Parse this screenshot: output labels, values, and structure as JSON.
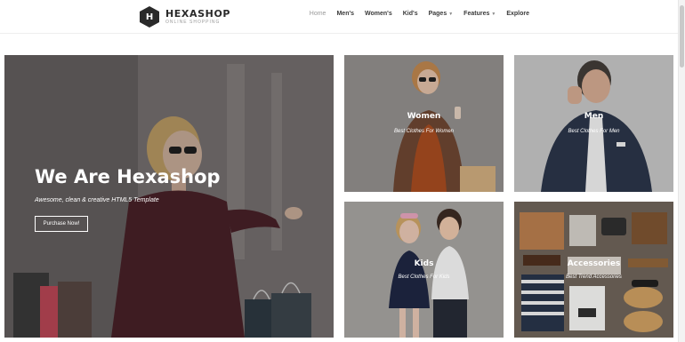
{
  "header": {
    "logo": {
      "letter": "H",
      "brand": "HEXASHOP",
      "tagline": "ONLINE SHOPPING"
    },
    "nav": [
      {
        "label": "Home",
        "active": true,
        "dropdown": false
      },
      {
        "label": "Men's",
        "active": false,
        "dropdown": false
      },
      {
        "label": "Women's",
        "active": false,
        "dropdown": false
      },
      {
        "label": "Kid's",
        "active": false,
        "dropdown": false
      },
      {
        "label": "Pages",
        "active": false,
        "dropdown": true
      },
      {
        "label": "Features",
        "active": false,
        "dropdown": true
      },
      {
        "label": "Explore",
        "active": false,
        "dropdown": false
      }
    ]
  },
  "hero": {
    "title": "We Are Hexashop",
    "subtitle": "Awesome, clean & creative HTML5 Template",
    "button_label": "Purchase Now!"
  },
  "categories": [
    {
      "title": "Women",
      "subtitle": "Best Clothes For Women"
    },
    {
      "title": "Men",
      "subtitle": "Best Clothes For Men"
    },
    {
      "title": "Kids",
      "subtitle": "Best Clothes For Kids"
    },
    {
      "title": "Accessories",
      "subtitle": "Best Trend Accessories"
    }
  ],
  "colors": {
    "logo_bg": "#2a2a2a",
    "text_dark": "#3a3a3a",
    "active_nav": "#9a9a9a"
  },
  "icons": {
    "logo": "hexagon-logo-icon",
    "dropdown": "chevron-down-icon"
  }
}
